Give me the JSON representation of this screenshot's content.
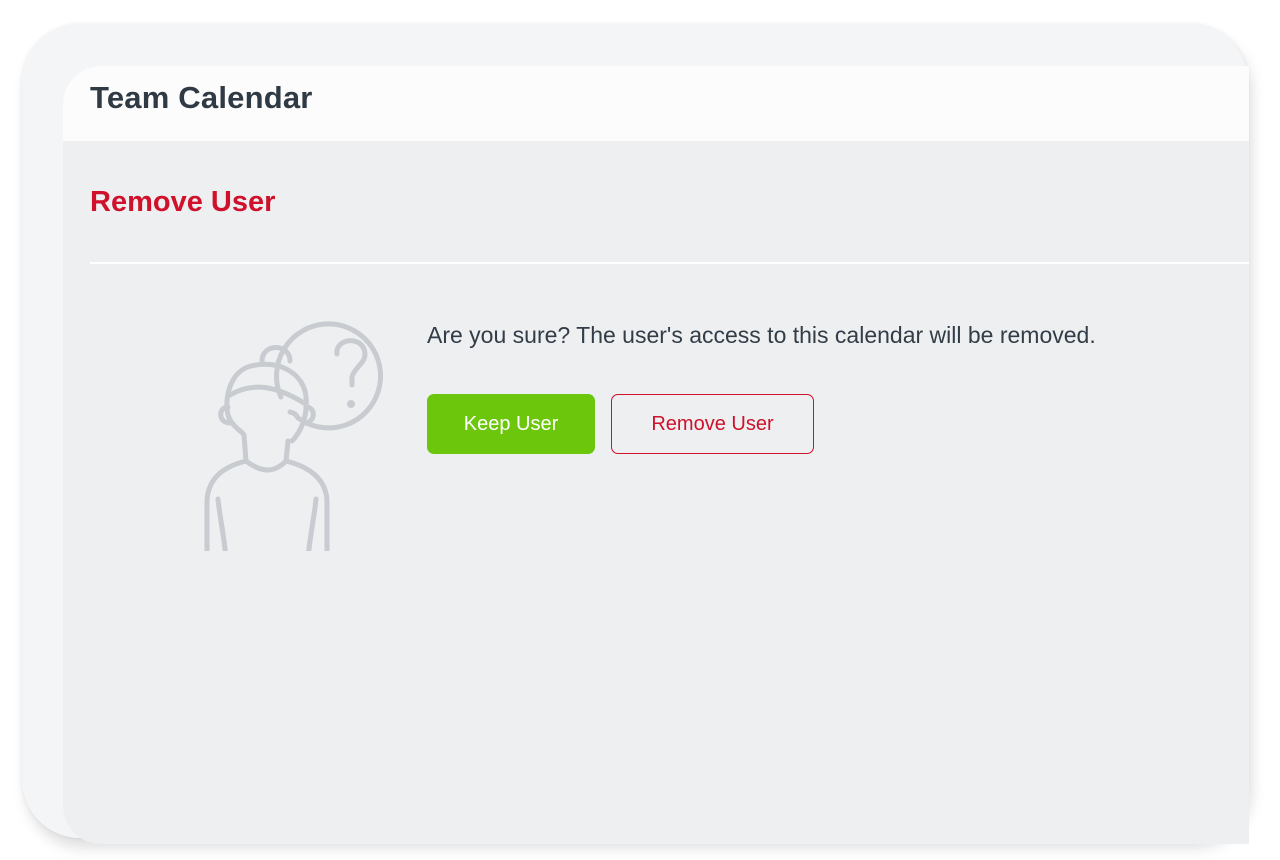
{
  "app": {
    "title": "Team Calendar"
  },
  "dialog": {
    "title": "Remove User",
    "message": "Are you sure? The user's access to this calendar will be removed.",
    "illustration_icon": "person-question-icon",
    "buttons": {
      "keep_label": "Keep User",
      "remove_label": "Remove User"
    }
  },
  "colors": {
    "danger": "#d0112b",
    "primary": "#6cc70c",
    "background": "#edeff1",
    "text": "#333d47"
  }
}
